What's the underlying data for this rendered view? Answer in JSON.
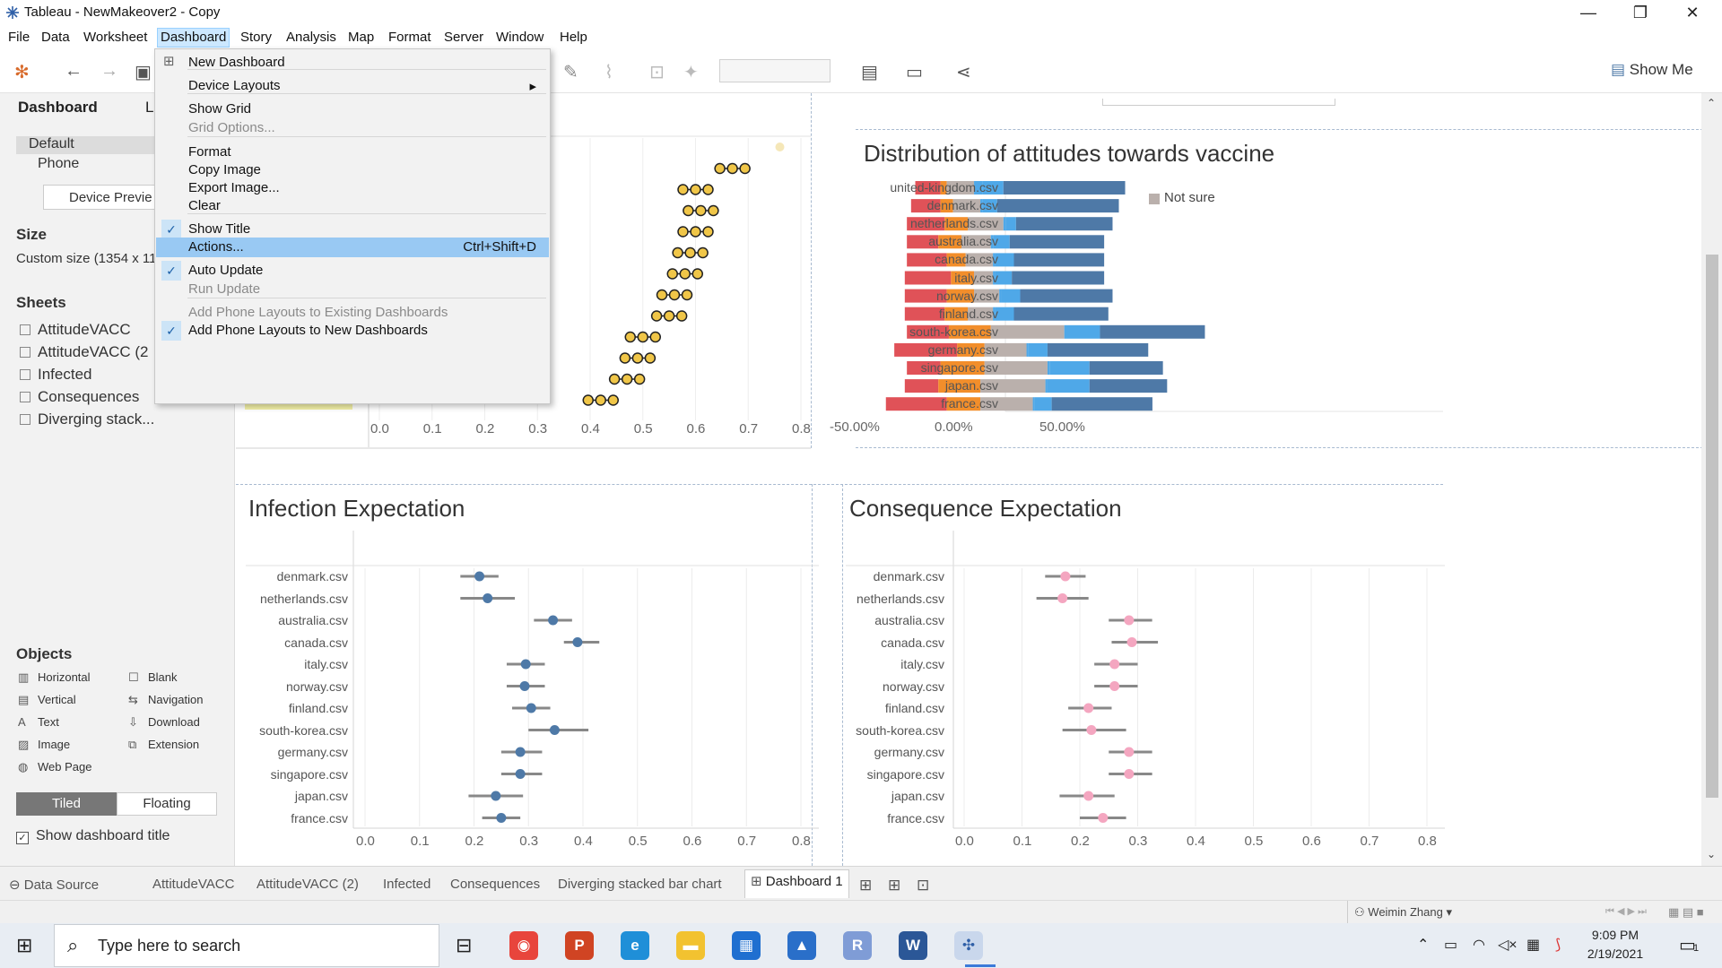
{
  "window": {
    "title": "Tableau - NewMakeover2 - Copy",
    "minimize": "—",
    "restore": "❐",
    "close": "✕"
  },
  "menubar": [
    "File",
    "Data",
    "Worksheet",
    "Dashboard",
    "Story",
    "Analysis",
    "Map",
    "Format",
    "Server",
    "Window",
    "Help"
  ],
  "toolbar": {
    "show_me": "Show Me"
  },
  "left_panel": {
    "tabs": [
      "Dashboard",
      "L"
    ],
    "device_options": [
      "Default",
      "Phone"
    ],
    "device_preview": "Device Previe",
    "size_heading": "Size",
    "size_value": "Custom size (1354 x 11",
    "sheets_heading": "Sheets",
    "sheets": [
      "AttitudeVACC",
      "AttitudeVACC (2",
      "Infected",
      "Consequences",
      "Diverging stack..."
    ],
    "objects_heading": "Objects",
    "objects": [
      {
        "label": "Horizontal",
        "icon": "▥"
      },
      {
        "label": "Blank",
        "icon": "☐"
      },
      {
        "label": "Vertical",
        "icon": "▤"
      },
      {
        "label": "Navigation",
        "icon": "⇆"
      },
      {
        "label": "Text",
        "icon": "A"
      },
      {
        "label": "Download",
        "icon": "⇩"
      },
      {
        "label": "Image",
        "icon": "▨"
      },
      {
        "label": "Extension",
        "icon": "⧉"
      },
      {
        "label": "Web Page",
        "icon": "◍"
      }
    ],
    "tiled": "Tiled",
    "floating": "Floating",
    "show_title": "Show dashboard title"
  },
  "dashboard_menu": {
    "items": [
      {
        "label": "New Dashboard",
        "state": "normal",
        "icon": "⊞"
      },
      {
        "label": "Device Layouts",
        "state": "submenu"
      },
      {
        "label": "Show Grid",
        "state": "normal"
      },
      {
        "label": "Grid Options...",
        "state": "disabled"
      },
      {
        "label": "Format",
        "state": "normal"
      },
      {
        "label": "Copy Image",
        "state": "normal"
      },
      {
        "label": "Export Image...",
        "state": "normal"
      },
      {
        "label": "Clear",
        "state": "normal"
      },
      {
        "label": "Show Title",
        "state": "checked"
      },
      {
        "label": "Actions...",
        "state": "highlighted",
        "shortcut": "Ctrl+Shift+D"
      },
      {
        "label": "Auto Update",
        "state": "checked"
      },
      {
        "label": "Run Update",
        "state": "disabled"
      },
      {
        "label": "Add Phone Layouts to Existing Dashboards",
        "state": "disabled"
      },
      {
        "label": "Add Phone Layouts to New Dashboards",
        "state": "checked"
      }
    ]
  },
  "canvas": {
    "legend_partial": "Not sure",
    "top_left_ticks": [
      "0.0",
      "0.1",
      "0.2",
      "0.3",
      "0.4",
      "0.5",
      "0.6",
      "0.7",
      "0.8"
    ]
  },
  "chart_data": [
    {
      "type": "scatter",
      "title": "",
      "x": [
        0.67,
        0.6,
        0.61,
        0.6,
        0.59,
        0.58,
        0.56,
        0.55,
        0.5,
        0.49,
        0.47,
        0.42
      ],
      "xlim": [
        0,
        0.8
      ],
      "ticks": [
        "0.0",
        "0.1",
        "0.2",
        "0.3",
        "0.4",
        "0.5",
        "0.6",
        "0.7",
        "0.8"
      ],
      "color": "#f0c648",
      "faded_point_x": 0.76
    },
    {
      "type": "bar",
      "title": "Distribution of attitudes towards vaccine",
      "categories": [
        "united-kingdom.csv",
        "denmark.csv",
        "netherlands.csv",
        "australia.csv",
        "canada.csv",
        "italy.csv",
        "norway.csv",
        "finland.csv",
        "south-korea.csv",
        "germany.csv",
        "singapore.csv",
        "japan.csv",
        "france.csv"
      ],
      "segments": [
        [
          -12,
          -3,
          -13,
          4,
          10,
          58
        ],
        [
          -14,
          -6,
          -13,
          -1,
          7,
          58
        ],
        [
          -18,
          -11,
          -17,
          -1,
          5,
          46
        ],
        [
          -15,
          -11,
          -14,
          -1,
          8,
          45
        ],
        [
          -19,
          -9,
          -13,
          -1,
          9,
          43
        ],
        [
          -22,
          -11,
          -9,
          -1,
          8,
          44
        ],
        [
          -20,
          -13,
          -12,
          -1,
          9,
          44
        ],
        [
          -19,
          -11,
          -12,
          -1,
          9,
          45
        ],
        [
          -20,
          -20,
          -35,
          -1,
          16,
          50
        ],
        [
          -30,
          -13,
          -20,
          -1,
          9,
          48
        ],
        [
          -16,
          -21,
          -30,
          -1,
          19,
          35
        ],
        [
          -16,
          -20,
          -31,
          -1,
          20,
          37
        ],
        [
          -29,
          -16,
          -25,
          -1,
          8,
          48
        ]
      ],
      "segment_start": [
        -22,
        -24,
        -26,
        -26,
        -26,
        -27,
        -27,
        -27,
        -26,
        -32,
        -26,
        -27,
        -36
      ],
      "segment_colors": [
        "#e05258",
        "#f28e2b",
        "#bab0ac",
        "#4fa8e8",
        "#4fa8e8",
        "#4e79a7"
      ],
      "xlim": [
        -70,
        90
      ],
      "ticks": [
        "-50.00%",
        "0.00%",
        "50.00%"
      ],
      "legend": [
        "Not sure"
      ]
    },
    {
      "type": "scatter",
      "title": "Infection Expectation",
      "categories": [
        "denmark.csv",
        "netherlands.csv",
        "australia.csv",
        "canada.csv",
        "italy.csv",
        "norway.csv",
        "finland.csv",
        "south-korea.csv",
        "germany.csv",
        "singapore.csv",
        "japan.csv",
        "france.csv"
      ],
      "values": [
        0.21,
        0.225,
        0.345,
        0.39,
        0.295,
        0.293,
        0.305,
        0.348,
        0.285,
        0.285,
        0.24,
        0.25
      ],
      "ci_low": [
        0.175,
        0.175,
        0.31,
        0.365,
        0.26,
        0.26,
        0.27,
        0.3,
        0.25,
        0.25,
        0.19,
        0.215
      ],
      "ci_high": [
        0.245,
        0.275,
        0.38,
        0.43,
        0.33,
        0.33,
        0.34,
        0.41,
        0.325,
        0.325,
        0.29,
        0.285
      ],
      "xlim": [
        0,
        0.8
      ],
      "ticks": [
        "0.0",
        "0.1",
        "0.2",
        "0.3",
        "0.4",
        "0.5",
        "0.6",
        "0.7",
        "0.8"
      ],
      "color": "#4e79a7"
    },
    {
      "type": "scatter",
      "title": "Consequence Expectation",
      "categories": [
        "denmark.csv",
        "netherlands.csv",
        "australia.csv",
        "canada.csv",
        "italy.csv",
        "norway.csv",
        "finland.csv",
        "south-korea.csv",
        "germany.csv",
        "singapore.csv",
        "japan.csv",
        "france.csv"
      ],
      "values": [
        0.175,
        0.17,
        0.285,
        0.29,
        0.26,
        0.26,
        0.215,
        0.22,
        0.285,
        0.285,
        0.215,
        0.24
      ],
      "ci_low": [
        0.14,
        0.125,
        0.25,
        0.255,
        0.225,
        0.225,
        0.18,
        0.17,
        0.25,
        0.25,
        0.165,
        0.2
      ],
      "ci_high": [
        0.21,
        0.215,
        0.325,
        0.335,
        0.3,
        0.3,
        0.255,
        0.28,
        0.325,
        0.325,
        0.26,
        0.28
      ],
      "xlim": [
        0,
        0.8
      ],
      "ticks": [
        "0.0",
        "0.1",
        "0.2",
        "0.3",
        "0.4",
        "0.5",
        "0.6",
        "0.7",
        "0.8"
      ],
      "color": "#f4a6c0"
    }
  ],
  "sheet_tabs": [
    "Data Source",
    "AttitudeVACC",
    "AttitudeVACC (2)",
    "Infected",
    "Consequences",
    "Diverging stacked bar chart",
    "Dashboard 1"
  ],
  "status": {
    "user": "Weimin Zhang"
  },
  "taskbar": {
    "search_placeholder": "Type here to search",
    "time": "9:09 PM",
    "date": "2/19/2021",
    "notifications": "1",
    "apps": [
      {
        "name": "Chrome",
        "color": "#e8453c",
        "glyph": "◉"
      },
      {
        "name": "PowerPoint",
        "color": "#d04423",
        "glyph": "P"
      },
      {
        "name": "Edge",
        "color": "#1f8fd8",
        "glyph": "e"
      },
      {
        "name": "File Explorer",
        "color": "#f2c230",
        "glyph": "▬"
      },
      {
        "name": "Calendar",
        "color": "#1f6fd0",
        "glyph": "▦"
      },
      {
        "name": "Photos",
        "color": "#2a6fc9",
        "glyph": "▲"
      },
      {
        "name": "R",
        "color": "#7f9cd6",
        "glyph": "R"
      },
      {
        "name": "Word",
        "color": "#2b5797",
        "glyph": "W"
      },
      {
        "name": "Tableau",
        "color": "#c9d7ec",
        "glyph": "✣"
      }
    ]
  }
}
